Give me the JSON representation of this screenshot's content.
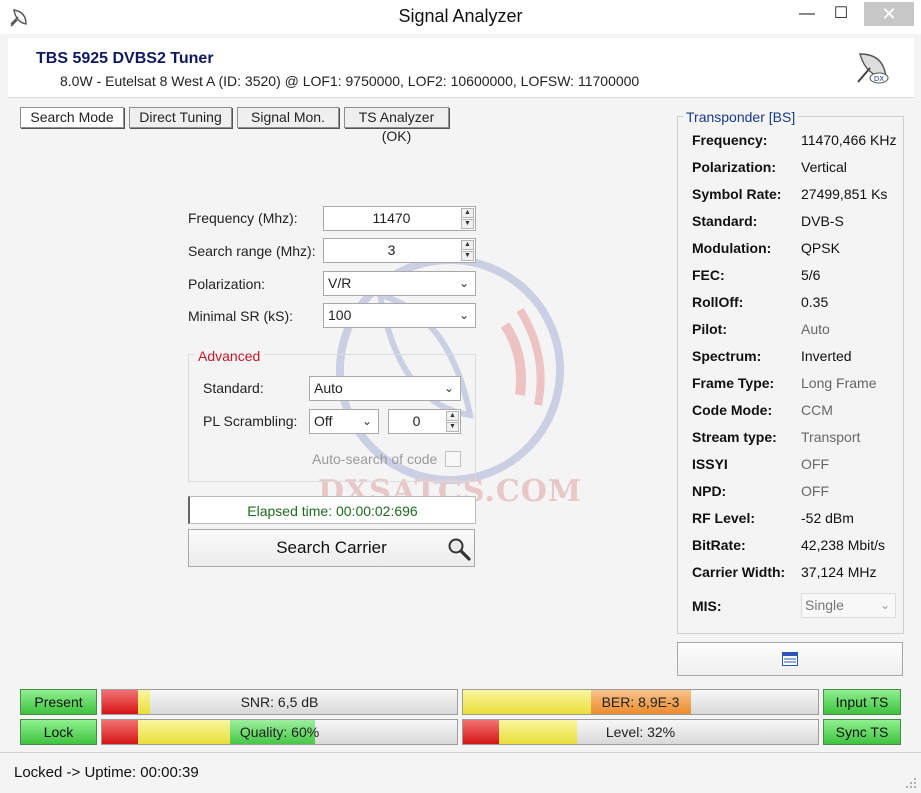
{
  "window": {
    "title": "Signal Analyzer",
    "buttons": {
      "minimize": "—",
      "maximize": "☐",
      "close": "✕"
    }
  },
  "header": {
    "tuner_name": "TBS 5925 DVBS2 Tuner",
    "tuner_info": "8.0W - Eutelsat 8 West A (ID: 3520) @ LOF1: 9750000, LOF2: 10600000, LOFSW: 11700000"
  },
  "tabs": [
    {
      "label": "Search Mode",
      "active": true
    },
    {
      "label": "Direct Tuning"
    },
    {
      "label": "Signal Mon."
    },
    {
      "label": "TS Analyzer (OK)"
    }
  ],
  "form": {
    "frequency_label": "Frequency (Mhz):",
    "frequency_value": "11470",
    "range_label": "Search range (Mhz):",
    "range_value": "3",
    "polarization_label": "Polarization:",
    "polarization_value": "V/R",
    "minsr_label": "Minimal SR (kS):",
    "minsr_value": "100",
    "advanced": {
      "legend": "Advanced",
      "standard_label": "Standard:",
      "standard_value": "Auto",
      "pls_label": "PL Scrambling:",
      "pls_mode": "Off",
      "pls_code": "0",
      "auto_search_label": "Auto-search of code"
    },
    "elapsed": "Elapsed time: 00:00:02:696",
    "search_button": "Search Carrier"
  },
  "transponder": {
    "legend": "Transponder [BS]",
    "rows": [
      {
        "key": "Frequency:",
        "value": "11470,466 KHz"
      },
      {
        "key": "Polarization:",
        "value": "Vertical"
      },
      {
        "key": "Symbol Rate:",
        "value": "27499,851 Ks"
      },
      {
        "key": "Standard:",
        "value": "DVB-S"
      },
      {
        "key": "Modulation:",
        "value": "QPSK"
      },
      {
        "key": "FEC:",
        "value": "5/6"
      },
      {
        "key": "RollOff:",
        "value": "0.35"
      },
      {
        "key": "Pilot:",
        "value": "Auto"
      },
      {
        "key": "Spectrum:",
        "value": "Inverted"
      },
      {
        "key": "Frame Type:",
        "value": "Long Frame"
      },
      {
        "key": "Code Mode:",
        "value": "CCM"
      },
      {
        "key": "Stream type:",
        "value": "Transport"
      },
      {
        "key": "ISSYI",
        "value": "OFF"
      },
      {
        "key": "NPD:",
        "value": "OFF"
      },
      {
        "key": "RF Level:",
        "value": "-52 dBm"
      },
      {
        "key": "BitRate:",
        "value": "42,238 Mbit/s"
      },
      {
        "key": "Carrier Width:",
        "value": "37,124 MHz"
      }
    ],
    "mis_label": "MIS:",
    "mis_value": "Single"
  },
  "status": {
    "present": "Present",
    "lock": "Lock",
    "input_ts": "Input TS",
    "sync_ts": "Sync TS",
    "snr": "SNR: 6,5 dB",
    "ber": "BER: 8,9E-3",
    "quality": "Quality: 60%",
    "level": "Level: 32%",
    "quality_fraction": 0.6,
    "level_fraction": 0.32,
    "colors": {
      "ok": "#3fc23f",
      "low": "#d51414",
      "mid": "#f0e040",
      "warn": "#f08a2a"
    }
  },
  "statusbar": {
    "text": "Locked -> Uptime: 00:00:39"
  },
  "watermark": {
    "text": "DXSATCS.COM"
  }
}
